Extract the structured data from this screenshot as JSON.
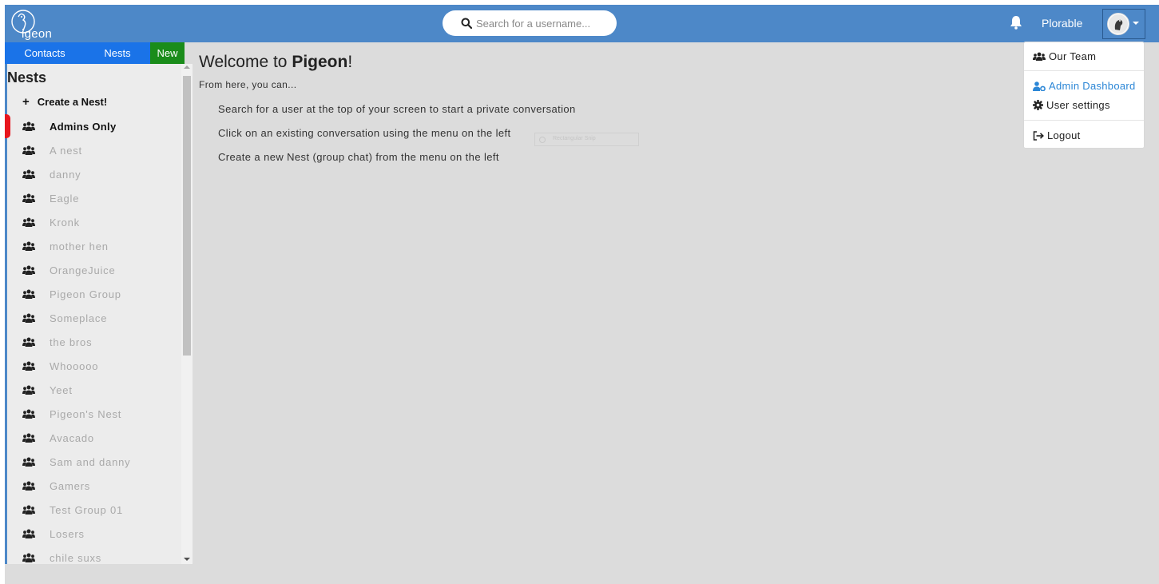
{
  "header": {
    "logo_text": "igeon",
    "search_placeholder": "Search for a username...",
    "username": "Plorable",
    "colors": {
      "bar": "#4d88c8"
    }
  },
  "tabs": {
    "contacts": "Contacts",
    "nests": "Nests",
    "new": "New",
    "colors": {
      "tab": "#1a73e8",
      "new": "#1a8c1a"
    }
  },
  "sidebar": {
    "title": "Nests",
    "create_label": "Create a Nest!",
    "active_marker_color": "#e8161e",
    "nests": [
      {
        "label": "Admins Only",
        "active": true
      },
      {
        "label": "A nest"
      },
      {
        "label": "danny"
      },
      {
        "label": "Eagle"
      },
      {
        "label": "Kronk"
      },
      {
        "label": "mother hen"
      },
      {
        "label": "OrangeJuice"
      },
      {
        "label": "Pigeon Group"
      },
      {
        "label": "Someplace"
      },
      {
        "label": "the bros"
      },
      {
        "label": "Whooooo"
      },
      {
        "label": "Yeet"
      },
      {
        "label": "Pigeon's Nest"
      },
      {
        "label": "Avacado"
      },
      {
        "label": "Sam and danny"
      },
      {
        "label": "Gamers"
      },
      {
        "label": "Test Group 01"
      },
      {
        "label": "Losers"
      },
      {
        "label": "chile suxs"
      }
    ]
  },
  "main": {
    "welcome_prefix": "Welcome to ",
    "welcome_brand": "Pigeon",
    "welcome_suffix": "!",
    "intro": "From here, you can...",
    "instructions": [
      "Search for a user at the top of your screen to start a private conversation",
      "Click on an existing conversation using the menu on the left",
      "Create a new Nest (group chat) from the menu on the left"
    ],
    "ghost_label": "Rectangular Snip"
  },
  "dropdown": {
    "our_team": "Our Team",
    "admin_dashboard": "Admin Dashboard",
    "user_settings": "User settings",
    "logout": "Logout",
    "icons": [
      "users-icon",
      "user-cog-icon",
      "gear-icon",
      "sign-out-icon"
    ]
  }
}
